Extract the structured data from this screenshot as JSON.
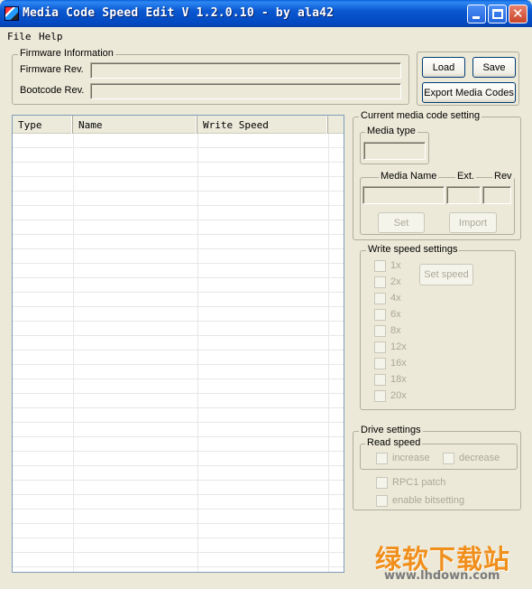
{
  "window": {
    "title": "Media Code Speed Edit V 1.2.0.10 - by ala42",
    "colors": {
      "titlebar": "#0a58d0",
      "face": "#ece9d8",
      "close": "#c9432a"
    }
  },
  "menu": {
    "items": [
      "File",
      "Help"
    ]
  },
  "firmware": {
    "legend": "Firmware Information",
    "firmware_rev_label": "Firmware Rev.",
    "firmware_rev_value": "",
    "bootcode_rev_label": "Bootcode Rev.",
    "bootcode_rev_value": ""
  },
  "actions": {
    "load": "Load",
    "save": "Save",
    "export": "Export Media Codes"
  },
  "list": {
    "columns": [
      "Type",
      "Name",
      "Write Speed"
    ],
    "rows": []
  },
  "current_setting": {
    "legend": "Current media code setting",
    "media_type_legend": "Media type",
    "media_name_label": "Media Name",
    "ext_label": "Ext.",
    "rev_label": "Rev",
    "set_button": "Set",
    "import_button": "Import"
  },
  "write_speed": {
    "legend": "Write speed settings",
    "speeds": [
      "1x",
      "2x",
      "4x",
      "6x",
      "8x",
      "12x",
      "16x",
      "18x",
      "20x"
    ],
    "set_speed_button": "Set speed"
  },
  "drive": {
    "legend": "Drive settings",
    "read_speed_legend": "Read speed",
    "increase": "increase",
    "decrease": "decrease",
    "rpc1": "RPC1 patch",
    "bitsetting": "enable bitsetting"
  },
  "watermark": {
    "logo": "绿软下载站",
    "url": "www.lhdown.com"
  }
}
